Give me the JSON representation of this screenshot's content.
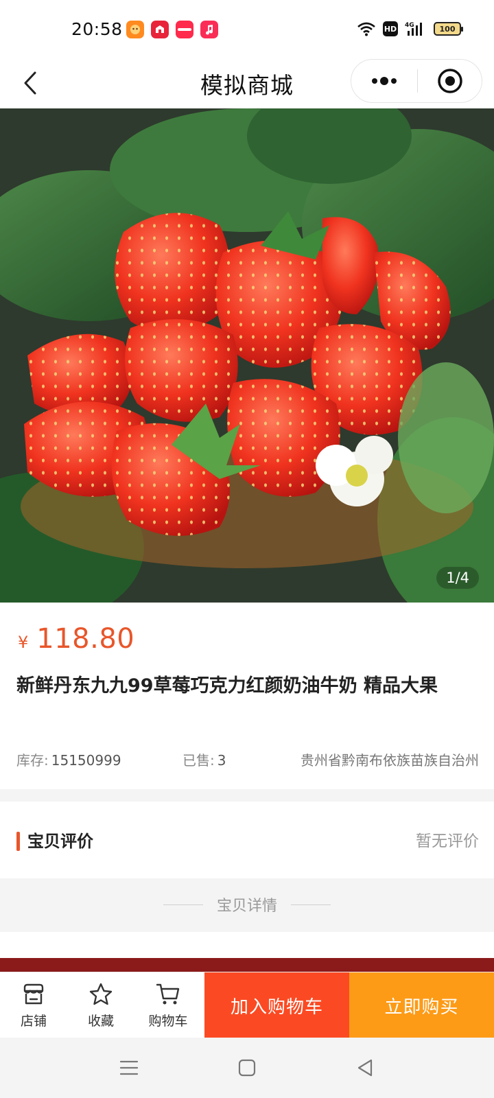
{
  "status_bar": {
    "time": "20:58",
    "network": "4G",
    "battery": "100",
    "app_icons": [
      "photo-app-icon",
      "red-app-icon",
      "xiaohongshu-icon",
      "music-app-icon"
    ]
  },
  "nav": {
    "title": "模拟商城"
  },
  "gallery": {
    "counter": "1/4"
  },
  "product": {
    "currency": "¥",
    "price": "118.80",
    "title": "新鲜丹东九九99草莓巧克力红颜奶油牛奶 精品大果",
    "stock_label": "库存:",
    "stock_value": "15150999",
    "sold_label": "已售:",
    "sold_value": "3",
    "location": "贵州省黔南布依族苗族自治州"
  },
  "reviews": {
    "title": "宝贝评价",
    "empty_text": "暂无评价"
  },
  "details": {
    "label": "宝贝详情"
  },
  "action_bar": {
    "shop_label": "店铺",
    "favorite_label": "收藏",
    "cart_label": "购物车",
    "add_to_cart": "加入购物车",
    "buy_now": "立即购买"
  },
  "colors": {
    "price": "#e8562a",
    "add_to_cart_bg": "#fb4a23",
    "buy_now_bg": "#fd9b17",
    "section_bg": "#f4f4f4"
  }
}
